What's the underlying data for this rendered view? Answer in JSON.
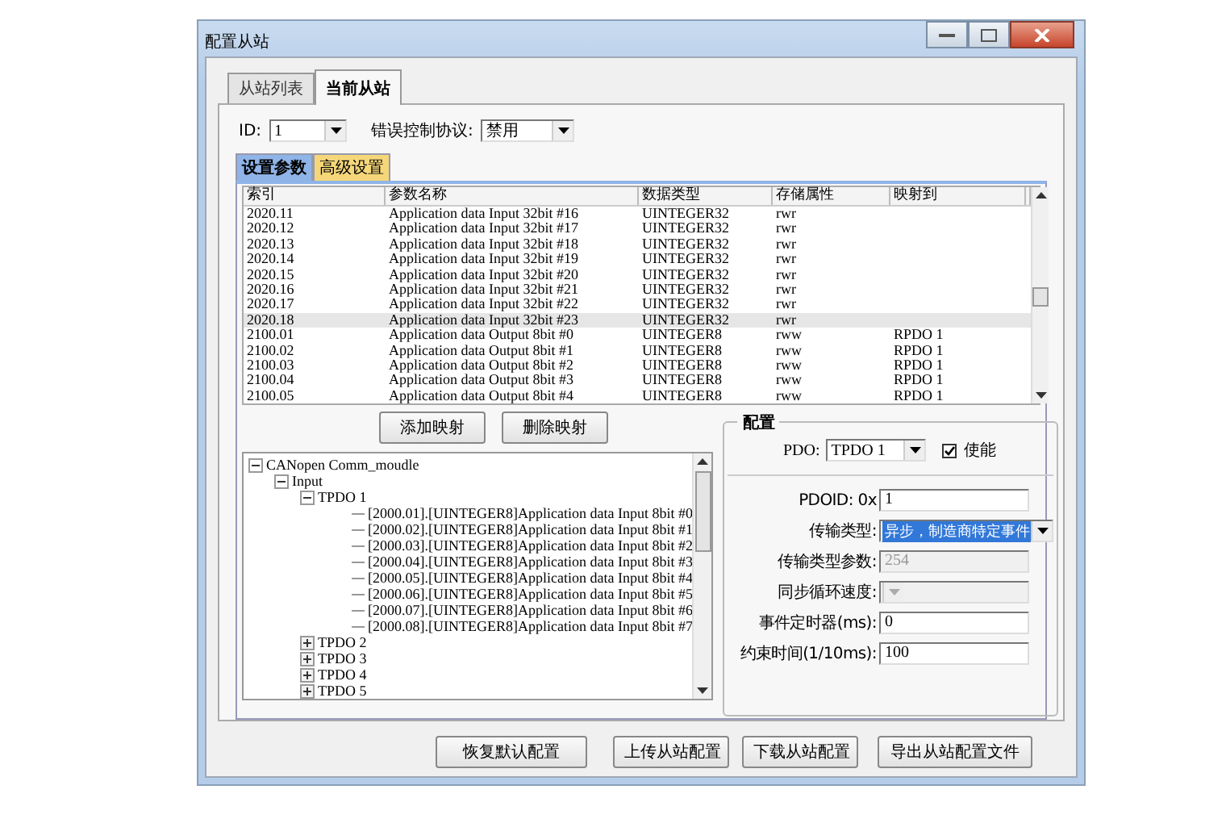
{
  "window": {
    "title": "配置从站"
  },
  "outer_tabs": [
    {
      "label": "从站列表",
      "selected": false
    },
    {
      "label": "当前从站",
      "selected": true
    }
  ],
  "id_field": {
    "label": "ID:",
    "value": "1"
  },
  "error_control": {
    "label": "错误控制协议:",
    "value": "禁用"
  },
  "inner_tabs": [
    {
      "label": "设置参数",
      "selected": true,
      "color": "#8fb4e8"
    },
    {
      "label": "高级设置",
      "selected": false,
      "color": "#f5d77a"
    }
  ],
  "table": {
    "columns": [
      "索引",
      "参数名称",
      "数据类型",
      "存储属性",
      "映射到"
    ],
    "rows": [
      {
        "cells": [
          "2020.11",
          "Application data Input 32bit #16",
          "UINTEGER32",
          "rwr",
          ""
        ],
        "selected": false
      },
      {
        "cells": [
          "2020.12",
          "Application data Input 32bit #17",
          "UINTEGER32",
          "rwr",
          ""
        ],
        "selected": false
      },
      {
        "cells": [
          "2020.13",
          "Application data Input 32bit #18",
          "UINTEGER32",
          "rwr",
          ""
        ],
        "selected": false
      },
      {
        "cells": [
          "2020.14",
          "Application data Input 32bit #19",
          "UINTEGER32",
          "rwr",
          ""
        ],
        "selected": false
      },
      {
        "cells": [
          "2020.15",
          "Application data Input 32bit #20",
          "UINTEGER32",
          "rwr",
          ""
        ],
        "selected": false
      },
      {
        "cells": [
          "2020.16",
          "Application data Input 32bit #21",
          "UINTEGER32",
          "rwr",
          ""
        ],
        "selected": false
      },
      {
        "cells": [
          "2020.17",
          "Application data Input 32bit #22",
          "UINTEGER32",
          "rwr",
          ""
        ],
        "selected": false
      },
      {
        "cells": [
          "2020.18",
          "Application data Input 32bit #23",
          "UINTEGER32",
          "rwr",
          ""
        ],
        "selected": true
      },
      {
        "cells": [
          "2100.01",
          "Application data Output 8bit #0",
          "UINTEGER8",
          "rww",
          "RPDO 1"
        ],
        "selected": false
      },
      {
        "cells": [
          "2100.02",
          "Application data Output 8bit #1",
          "UINTEGER8",
          "rww",
          "RPDO 1"
        ],
        "selected": false
      },
      {
        "cells": [
          "2100.03",
          "Application data Output 8bit #2",
          "UINTEGER8",
          "rww",
          "RPDO 1"
        ],
        "selected": false
      },
      {
        "cells": [
          "2100.04",
          "Application data Output 8bit #3",
          "UINTEGER8",
          "rww",
          "RPDO 1"
        ],
        "selected": false
      },
      {
        "cells": [
          "2100.05",
          "Application data Output 8bit #4",
          "UINTEGER8",
          "rww",
          "RPDO 1"
        ],
        "selected": false
      }
    ]
  },
  "map_buttons": [
    "添加映射",
    "删除映射"
  ],
  "tree": [
    {
      "label": "CANopen Comm_moudle",
      "expanded": true,
      "children": [
        {
          "label": "Input",
          "expanded": true,
          "children": [
            {
              "label": "TPDO 1",
              "expanded": true,
              "children": [
                {
                  "label": "[2000.01].[UINTEGER8]Application data Input 8bit #0"
                },
                {
                  "label": "[2000.02].[UINTEGER8]Application data Input 8bit #1"
                },
                {
                  "label": "[2000.03].[UINTEGER8]Application data Input 8bit #2"
                },
                {
                  "label": "[2000.04].[UINTEGER8]Application data Input 8bit #3"
                },
                {
                  "label": "[2000.05].[UINTEGER8]Application data Input 8bit #4"
                },
                {
                  "label": "[2000.06].[UINTEGER8]Application data Input 8bit #5"
                },
                {
                  "label": "[2000.07].[UINTEGER8]Application data Input 8bit #6"
                },
                {
                  "label": "[2000.08].[UINTEGER8]Application data Input 8bit #7"
                }
              ]
            },
            {
              "label": "TPDO 2",
              "expanded": false
            },
            {
              "label": "TPDO 3",
              "expanded": false
            },
            {
              "label": "TPDO 4",
              "expanded": false
            },
            {
              "label": "TPDO 5",
              "expanded": false
            }
          ]
        }
      ]
    }
  ],
  "config": {
    "title": "配置",
    "pdo": {
      "label": "PDO:",
      "value": "TPDO 1"
    },
    "enable": {
      "label": "使能",
      "checked": true
    },
    "fields": [
      {
        "kind": "text",
        "label": "PDOID: 0x",
        "value": "1",
        "disabled": false
      },
      {
        "kind": "select",
        "label": "传输类型:",
        "value": "异步，制造商特定事件",
        "disabled": false
      },
      {
        "kind": "text",
        "label": "传输类型参数:",
        "value": "254",
        "disabled": true
      },
      {
        "kind": "select",
        "label": "同步循环速度:",
        "disabled": true
      },
      {
        "kind": "text",
        "label": "事件定时器(ms):",
        "value": "0",
        "disabled": false
      },
      {
        "kind": "text",
        "label": "约束时间(1/10ms):",
        "value": "100",
        "disabled": false
      }
    ]
  },
  "bottom_buttons": [
    "恢复默认配置",
    "上传从站配置",
    "下载从站配置",
    "导出从站配置文件"
  ]
}
